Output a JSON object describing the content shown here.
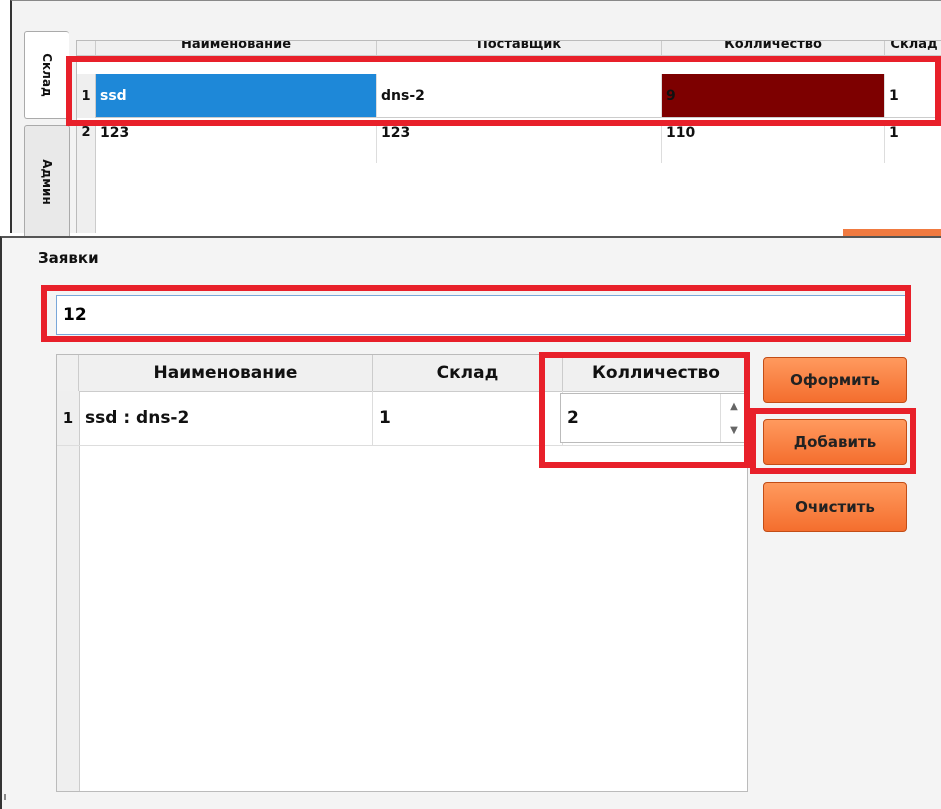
{
  "tabs": [
    {
      "label": "Склад"
    },
    {
      "label": "Админ"
    }
  ],
  "warehouse_table": {
    "headers": [
      "Наименование",
      "Поставщик",
      "Колличество",
      "Склад"
    ],
    "rows": [
      {
        "num": "1",
        "name": "ssd",
        "supplier": "dns-2",
        "quantity": "9",
        "warehouse": "1"
      },
      {
        "num": "2",
        "name": "123",
        "supplier": "123",
        "quantity": "110",
        "warehouse": "1"
      }
    ]
  },
  "requests": {
    "title": "Заявки",
    "input_value": "12",
    "table": {
      "headers": [
        "Наименование",
        "Склад",
        "Колличество"
      ],
      "rows": [
        {
          "num": "1",
          "name": "ssd : dns-2",
          "warehouse": "1",
          "quantity": "2"
        }
      ]
    },
    "buttons": {
      "submit": "Оформить",
      "add": "Добавить",
      "clear": "Очистить"
    }
  },
  "colors": {
    "highlight": "#e8202a",
    "selection_blue": "#1e88d8",
    "selection_dark": "#7d0000",
    "button_orange": "#f46e2e"
  }
}
